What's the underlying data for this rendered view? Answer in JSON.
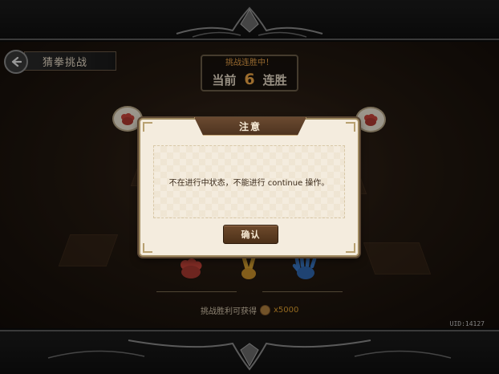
{
  "header": {
    "back_icon": "back-arrow-icon",
    "title": "猜拳挑战"
  },
  "streak": {
    "status": "挑战连胜中！",
    "prefix": "当前",
    "count": "6",
    "suffix": "连胜"
  },
  "opponent_bubbles": [
    "rock-hand-icon",
    "rock-hand-icon"
  ],
  "hands": [
    {
      "name": "rock",
      "icon": "rock-hand-icon",
      "color": "#c8443a"
    },
    {
      "name": "scissors",
      "icon": "scissors-hand-icon",
      "color": "#d8a030"
    },
    {
      "name": "paper",
      "icon": "paper-hand-icon",
      "color": "#3a78c8"
    }
  ],
  "reward": {
    "label": "挑战胜利可获得",
    "coin_icon": "coin-icon",
    "amount": "x5000"
  },
  "uid": "UID:14127",
  "dialog": {
    "title": "注意",
    "message": "不在进行中状态，不能进行 continue 操作。",
    "confirm_label": "确认"
  },
  "colors": {
    "accent_orange": "#f0a848",
    "dialog_bg": "#f4ecde",
    "button_brown": "#5c3c22"
  }
}
